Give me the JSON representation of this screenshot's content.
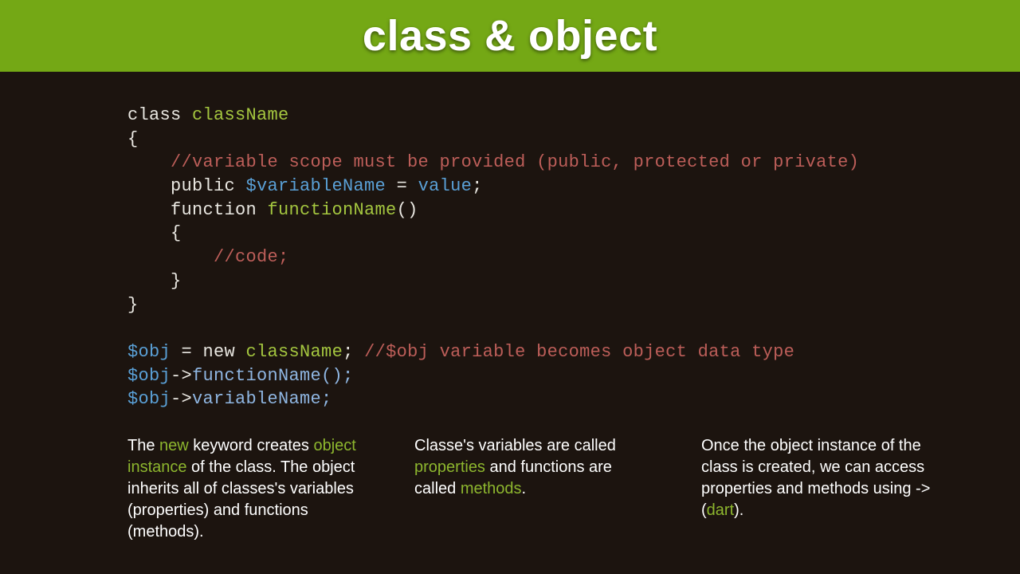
{
  "header": {
    "title": "class & object"
  },
  "code": {
    "l1_class": "class ",
    "l1_name": "className",
    "l2": "{",
    "l3_comment": "    //variable scope must be provided (public, protected or private)",
    "l4_pub": "    public ",
    "l4_var": "$variableName",
    "l4_eq": " = ",
    "l4_val": "value",
    "l4_semi": ";",
    "l5_func": "    function ",
    "l5_name": "functionName",
    "l5_paren": "()",
    "l6": "    {",
    "l7_comment": "        //code;",
    "l8": "    }",
    "l9": "}",
    "nl1": "",
    "l10_obj": "$obj",
    "l10_eq": " = ",
    "l10_new": "new ",
    "l10_name": "className",
    "l10_semi": "; ",
    "l10_comment": "//$obj variable becomes object data type",
    "l11_obj": "$obj",
    "l11_arrow": "->",
    "l11_member": "functionName();",
    "l12_obj": "$obj",
    "l12_arrow": "->",
    "l12_member": "variableName;"
  },
  "explain": {
    "col1": {
      "a": "The ",
      "b": "new",
      "c": " keyword creates ",
      "d": "object instance",
      "e": " of the class. The object inherits all of classes's variables (properties) and functions (methods)."
    },
    "col2": {
      "a": "Classe's variables are called ",
      "b": "properties",
      "c": " and functions are called ",
      "d": "methods",
      "e": "."
    },
    "col3": {
      "a": "Once the object instance of the class is created, we can access properties and methods using -> (",
      "b": "dart",
      "c": ")."
    }
  }
}
